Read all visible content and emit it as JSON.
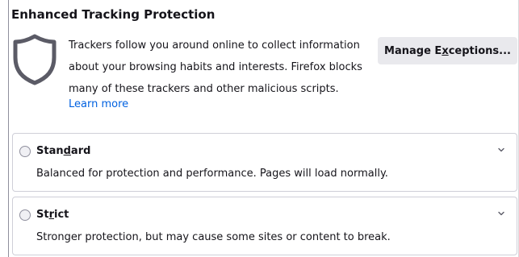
{
  "section": {
    "title": "Enhanced Tracking Protection",
    "description_lines": [
      "Trackers follow you around online to collect information",
      "about your browsing habits and interests. Firefox blocks",
      "many of these trackers and other malicious scripts."
    ],
    "learn_more": "Learn more",
    "manage_button": {
      "prefix": "Manage E",
      "accesskey": "x",
      "suffix": "ceptions..."
    },
    "shield_icon": "shield-icon"
  },
  "options": {
    "standard": {
      "label_prefix": "Stan",
      "accesskey": "d",
      "label_suffix": "ard",
      "description": "Balanced for protection and performance. Pages will load normally.",
      "selected": false
    },
    "strict": {
      "label_prefix": "St",
      "accesskey": "r",
      "label_suffix": "ict",
      "description": "Stronger protection, but may cause some sites or content to break.",
      "selected": false
    }
  },
  "colors": {
    "link": "#0061e0",
    "button_bg": "#e9e9ed",
    "border": "#cfcfd8",
    "text": "#15141a"
  }
}
